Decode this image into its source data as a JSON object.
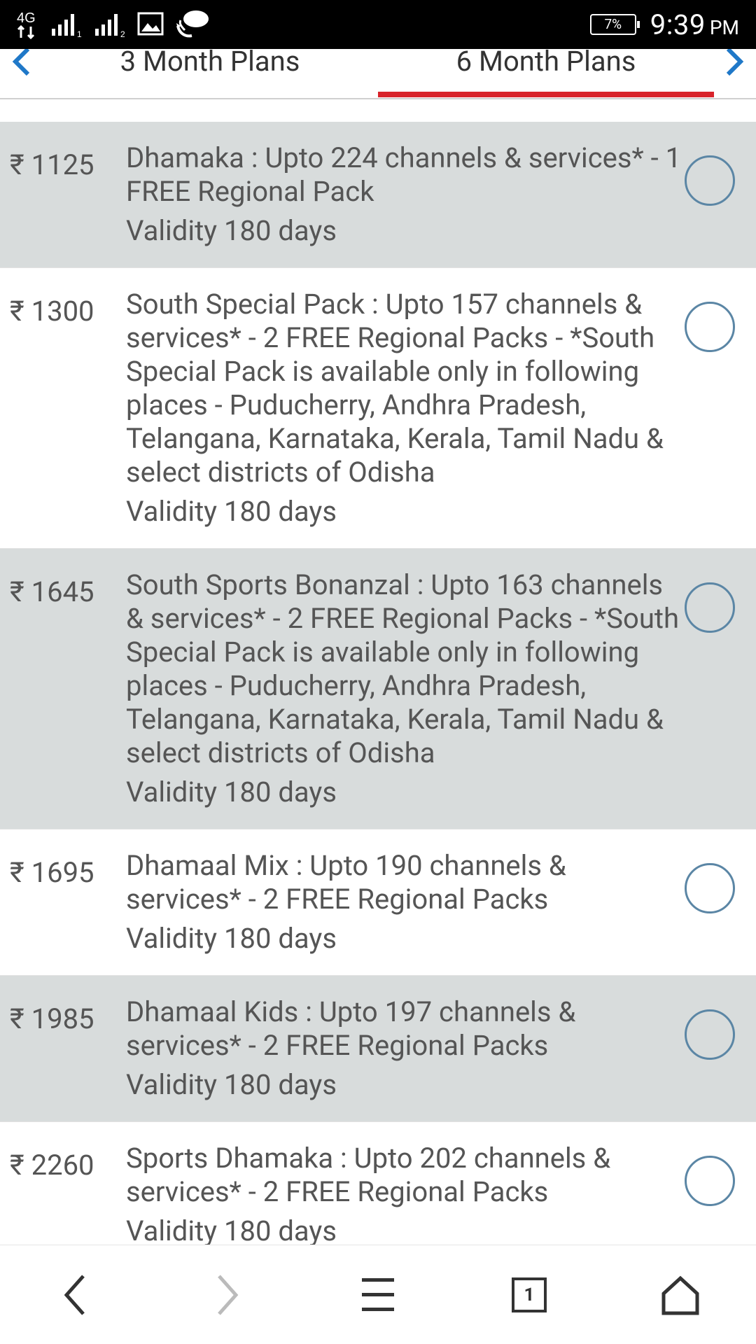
{
  "status_bar": {
    "network": "4G",
    "sim1_label": "1",
    "sim2_label": "2",
    "battery": "7%",
    "time": "9:39",
    "ampm": "PM"
  },
  "tabs": {
    "items": [
      {
        "label": "3 Month Plans",
        "active": false
      },
      {
        "label": "6 Month Plans",
        "active": true
      }
    ]
  },
  "currency_symbol": "₹",
  "plans": [
    {
      "price": "1125",
      "description": "Dhamaka : Upto 224 channels & services* - 1 FREE Regional Pack",
      "validity": "Validity 180 days",
      "shaded": true
    },
    {
      "price": "1300",
      "description": "South Special Pack : Upto 157 channels & services* - 2 FREE Regional Packs - *South Special Pack is available only in following places - Puducherry, Andhra Pradesh, Telangana, Karnataka, Kerala, Tamil Nadu & select districts of Odisha",
      "validity": "Validity 180 days",
      "shaded": false
    },
    {
      "price": "1645",
      "description": "South Sports Bonanzal : Upto 163 channels & services* - 2 FREE Regional Packs - *South Special Pack is available only in following places - Puducherry, Andhra Pradesh, Telangana, Karnataka, Kerala, Tamil Nadu & select districts of Odisha",
      "validity": "Validity 180 days",
      "shaded": true
    },
    {
      "price": "1695",
      "description": "Dhamaal Mix : Upto 190 channels & services* - 2 FREE Regional Packs",
      "validity": "Validity 180 days",
      "shaded": false
    },
    {
      "price": "1985",
      "description": "Dhamaal Kids : Upto 197 channels & services* - 2 FREE Regional Packs",
      "validity": "Validity 180 days",
      "shaded": true
    },
    {
      "price": "2260",
      "description": "Sports Dhamaka : Upto 202 channels & services* - 2 FREE Regional Packs",
      "validity": "Validity 180 days",
      "shaded": false
    }
  ],
  "bottom_nav": {
    "tab_count": "1"
  },
  "colors": {
    "accent_red": "#d8232a",
    "link_blue": "#1f78c8",
    "row_shade": "#d8dcdc",
    "radio_border": "#5b86a5"
  }
}
